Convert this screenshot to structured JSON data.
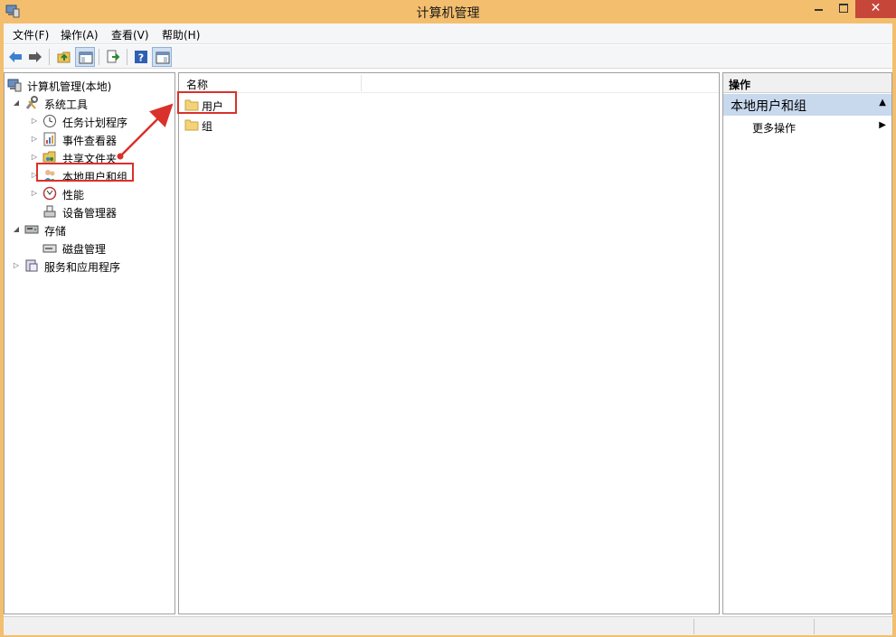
{
  "window": {
    "title": "计算机管理"
  },
  "menubar": {
    "items": [
      {
        "label": "文件(F)"
      },
      {
        "label": "操作(A)"
      },
      {
        "label": "查看(V)"
      },
      {
        "label": "帮助(H)"
      }
    ]
  },
  "toolbar": {
    "buttons": [
      {
        "icon": "back-arrow-icon"
      },
      {
        "icon": "forward-arrow-icon"
      },
      {
        "icon": "up-folder-icon"
      },
      {
        "icon": "show-hide-tree-icon"
      },
      {
        "icon": "export-list-icon"
      },
      {
        "icon": "help-icon"
      },
      {
        "icon": "show-hide-action-pane-icon"
      }
    ]
  },
  "tree": {
    "root": {
      "label": "计算机管理(本地)"
    },
    "items": [
      {
        "label": "系统工具",
        "toggle": "◢"
      },
      {
        "label": "任务计划程序",
        "toggle": "▷"
      },
      {
        "label": "事件查看器",
        "toggle": "▷"
      },
      {
        "label": "共享文件夹",
        "toggle": "▷"
      },
      {
        "label": "本地用户和组",
        "toggle": "▷"
      },
      {
        "label": "性能",
        "toggle": "▷"
      },
      {
        "label": "设备管理器",
        "toggle": ""
      },
      {
        "label": "存储",
        "toggle": "◢"
      },
      {
        "label": "磁盘管理",
        "toggle": ""
      },
      {
        "label": "服务和应用程序",
        "toggle": "▷"
      }
    ]
  },
  "list": {
    "columns": [
      "名称"
    ],
    "rows": [
      {
        "label": "用户"
      },
      {
        "label": "组"
      }
    ]
  },
  "actions": {
    "header": "操作",
    "section": "本地用户和组",
    "items": [
      {
        "label": "更多操作"
      }
    ]
  },
  "colors": {
    "frame": "#f3be6e",
    "close_button": "#c7463a",
    "annotation": "#d9312b",
    "action_section": "#c8d9ee"
  }
}
